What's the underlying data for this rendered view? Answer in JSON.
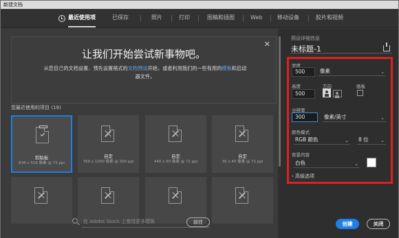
{
  "window": {
    "title": "新建文档"
  },
  "tabs": [
    {
      "label": "最近使用项",
      "active": true
    },
    {
      "label": "已保存"
    },
    {
      "label": "照片"
    },
    {
      "label": "打印"
    },
    {
      "label": "图稿和插图"
    },
    {
      "label": "Web"
    },
    {
      "label": "移动设备"
    },
    {
      "label": "胶片和视频"
    }
  ],
  "welcome": {
    "headline": "让我们开始尝试新事物吧。",
    "desc_part1": "从您自己的文档设置、预先设置格式的",
    "desc_link1": "文档预设",
    "desc_part2": "开始，或者利用我们的一些有用的",
    "desc_link2": "模板",
    "desc_part3": "和启动器文件。"
  },
  "recent": {
    "heading": "您最近使用的项目",
    "count": "(19)",
    "items": [
      {
        "name": "剪贴板",
        "dims": "836 x 516 像素 @ 72 ppi",
        "selected": true
      },
      {
        "name": "自定",
        "dims": "769 x 1000 像素 @ 300 ppi"
      },
      {
        "name": "自定",
        "dims": "440 x 50 像素 @ 72 ppi"
      },
      {
        "name": "自定",
        "dims": "30 x 40 像素 @ 72 ppi"
      },
      {
        "name": "",
        "dims": ""
      },
      {
        "name": "",
        "dims": ""
      },
      {
        "name": "",
        "dims": ""
      },
      {
        "name": "",
        "dims": ""
      }
    ]
  },
  "search": {
    "placeholder": "在 Adobe Stock 上查找更多模板",
    "go_label": "前往"
  },
  "details": {
    "section_title": "预设详细信息",
    "doc_title": "未标题-1",
    "width_label": "宽度",
    "width_value": "500",
    "width_unit": "像素",
    "height_label": "高度",
    "height_value": "500",
    "orientation_label": "方向",
    "artboard_label": "画板",
    "resolution_label": "分辨率",
    "resolution_value": "300",
    "resolution_unit": "像素/英寸",
    "color_mode_label": "颜色模式",
    "color_mode_value": "RGB 颜色",
    "bit_depth": "8 位",
    "background_label": "背景内容",
    "background_value": "白色",
    "background_color": "#ffffff",
    "advanced_label": "高级选项"
  },
  "buttons": {
    "create": "创建",
    "close": "关闭"
  },
  "colors": {
    "accent": "#1f7fe5",
    "highlight_box": "#e02020"
  }
}
